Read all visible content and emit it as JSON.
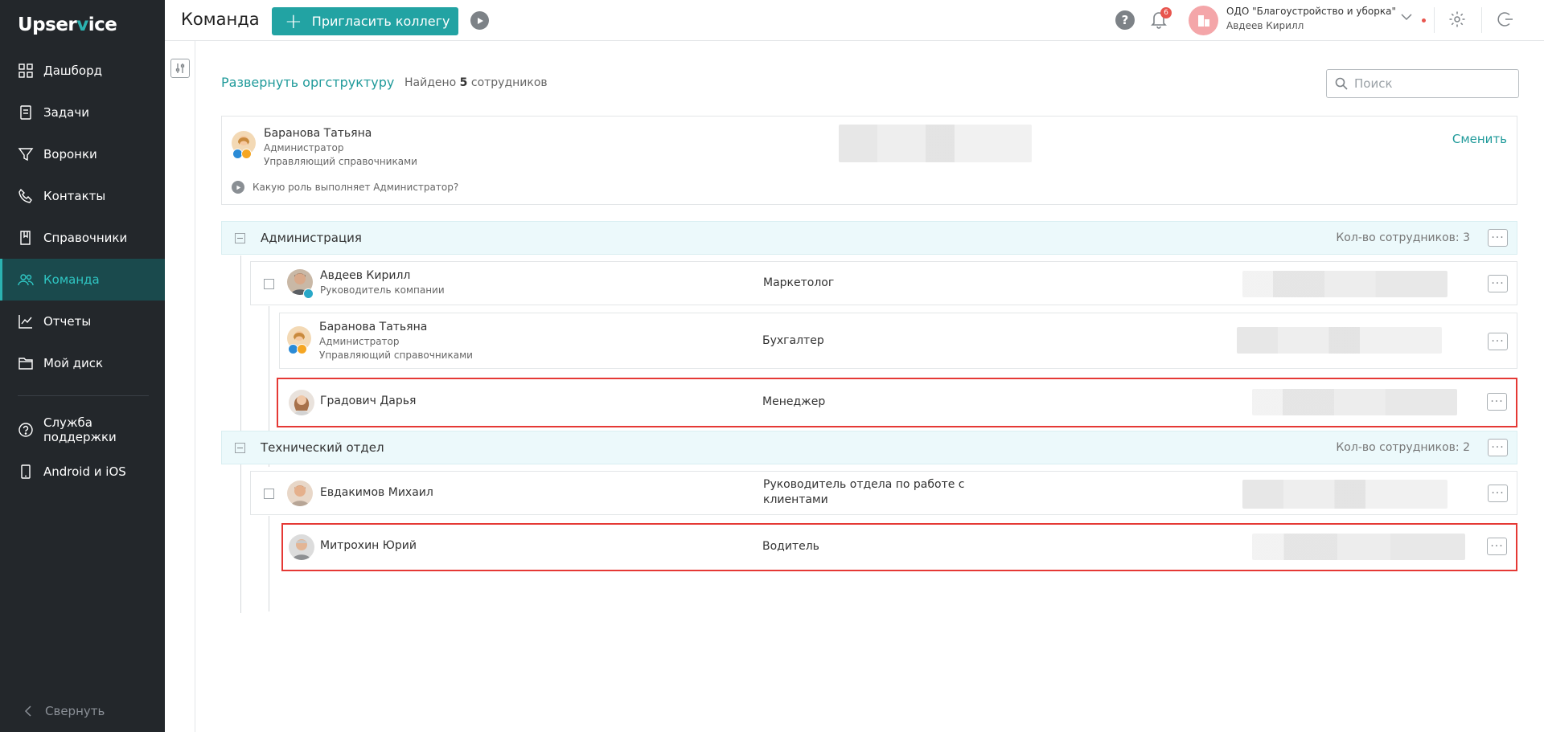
{
  "app": {
    "logo_prefix": "Upser",
    "logo_v": "v",
    "logo_suffix": "ice"
  },
  "sidebar": {
    "items": [
      {
        "label": "Дашборд",
        "icon": "grid-icon"
      },
      {
        "label": "Задачи",
        "icon": "tasks-icon"
      },
      {
        "label": "Воронки",
        "icon": "funnel-icon"
      },
      {
        "label": "Контакты",
        "icon": "phone-icon"
      },
      {
        "label": "Справочники",
        "icon": "book-icon"
      },
      {
        "label": "Команда",
        "icon": "team-icon",
        "active": true
      },
      {
        "label": "Отчеты",
        "icon": "chart-icon"
      },
      {
        "label": "Мой диск",
        "icon": "folder-icon"
      },
      {
        "label": "Служба поддержки",
        "icon": "help-circle-icon"
      },
      {
        "label": "Android и iOS",
        "icon": "mobile-icon"
      }
    ],
    "collapse_label": "Свернуть"
  },
  "header": {
    "title": "Команда",
    "invite_label": "Пригласить коллегу",
    "help_symbol": "?",
    "notifications_count": "6",
    "org_name": "ОДО \"Благоустройство и уборка\"",
    "org_user": "Авдеев Кирилл"
  },
  "main": {
    "expand_link": "Развернуть оргструктуру",
    "found_prefix": "Найдено",
    "found_count": "5",
    "found_suffix": "сотрудников",
    "search_placeholder": "Поиск",
    "admin": {
      "name": "Баранова Татьяна",
      "role": "Администратор",
      "role2": "Управляющий справочниками",
      "question": "Какую роль выполняет Администратор?",
      "change_label": "Сменить"
    },
    "departments": [
      {
        "name": "Администрация",
        "count_label": "Кол-во сотрудников: 3",
        "members": [
          {
            "name": "Авдеев Кирилл",
            "sub": "Руководитель компании",
            "position": "Маркетолог"
          },
          {
            "name": "Баранова Татьяна",
            "sub": "Администратор",
            "sub2": "Управляющий справочниками",
            "position": "Бухгалтер"
          },
          {
            "name": "Градович Дарья",
            "position": "Менеджер",
            "highlighted": true
          }
        ]
      },
      {
        "name": "Технический отдел",
        "count_label": "Кол-во сотрудников: 2",
        "members": [
          {
            "name": "Евдакимов Михаил",
            "position_line1": "Руководитель отдела по работе с",
            "position_line2": "клиентами"
          },
          {
            "name": "Митрохин Юрий",
            "position": "Водитель",
            "highlighted": true
          }
        ]
      }
    ],
    "more_symbol": "···"
  },
  "colors": {
    "accent": "#22a3a3",
    "sidebar_bg": "#23272b",
    "highlight": "#e53935",
    "dept_bg": "#ecf9fb"
  }
}
